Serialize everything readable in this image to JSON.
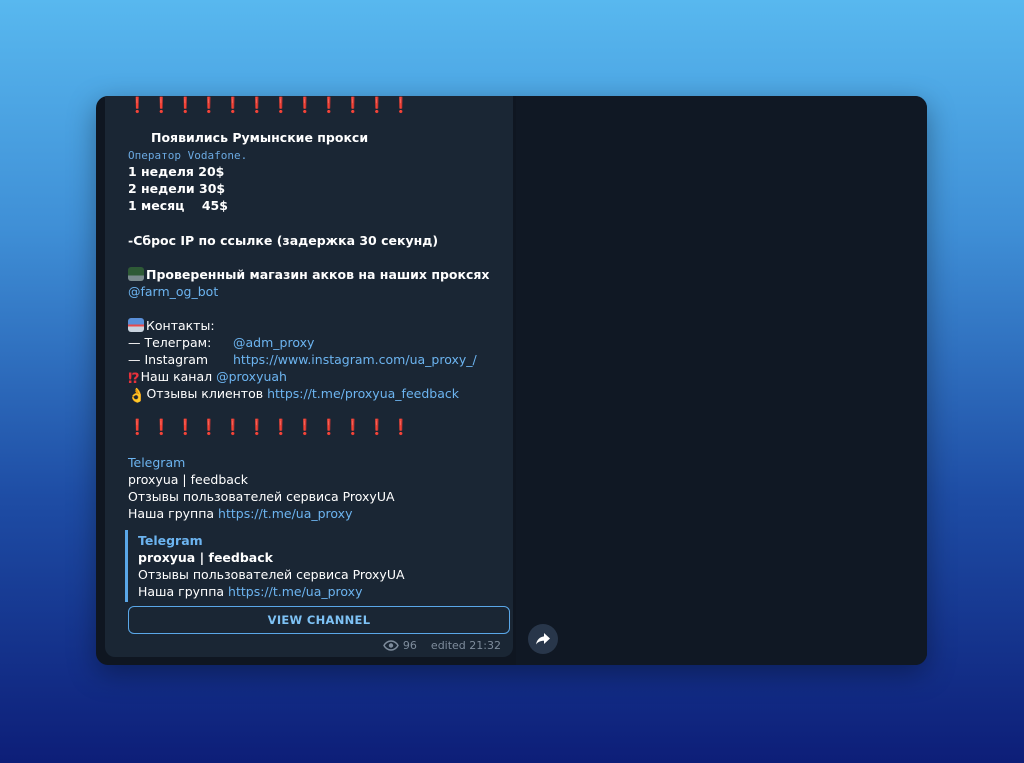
{
  "post": {
    "excl_top": "❗❗❗❗❗❗❗❗❗❗❗❗",
    "headline": "Появились Румынские прокси",
    "operator": "Оператор Vodafone.",
    "price_week": "1 неделя 20$",
    "price_2weeks": "2 недели 30$",
    "price_month": "1 месяц    45$",
    "ip_reset": "-Сброс IP по ссылке (задержка 30 секунд)",
    "shop_text": "Проверенный магазин акков на наших проксях",
    "shop_bot": "@farm_og_bot",
    "contacts_label": "Контакты:",
    "telegram_label": "— Телеграм:",
    "telegram_handle": "@adm_proxy",
    "instagram_label": "— Instagram",
    "instagram_link": "https://www.instagram.com/ua_proxy_/",
    "channel_label": "Наш канал",
    "channel_handle": "@proxyuah",
    "reviews_label": "Отзывы клиентов",
    "reviews_link": "https://t.me/proxyua_feedback",
    "excl_bottom": "❗❗❗❗❗❗❗❗❗❗❗❗",
    "preview": {
      "site": "Telegram",
      "title": "proxyua | feedback",
      "desc": "Отзывы пользователей сервиса ProxyUA",
      "group_label": "Наша группа",
      "group_link": "https://t.me/ua_proxy"
    },
    "quote": {
      "site": "Telegram",
      "title": "proxyua | feedback",
      "desc": "Отзывы пользователей сервиса ProxyUA",
      "group_label": "Наша группа",
      "group_link": "https://t.me/ua_proxy"
    },
    "view_channel": "VIEW CHANNEL",
    "views": "96",
    "edited": "edited 21:32"
  },
  "icons": {
    "laptop": "laptop-icon",
    "inbox": "inbox-tray-icon",
    "interrobang": "exclamation-question-icon",
    "ok_hand": "ok-hand-icon",
    "eye": "eye-icon",
    "share": "share-arrow-icon"
  },
  "colors": {
    "link": "#6cb4f0",
    "exclamation": "#e8313b",
    "bubble": "#1a2634",
    "accent": "#5aa7e8"
  }
}
